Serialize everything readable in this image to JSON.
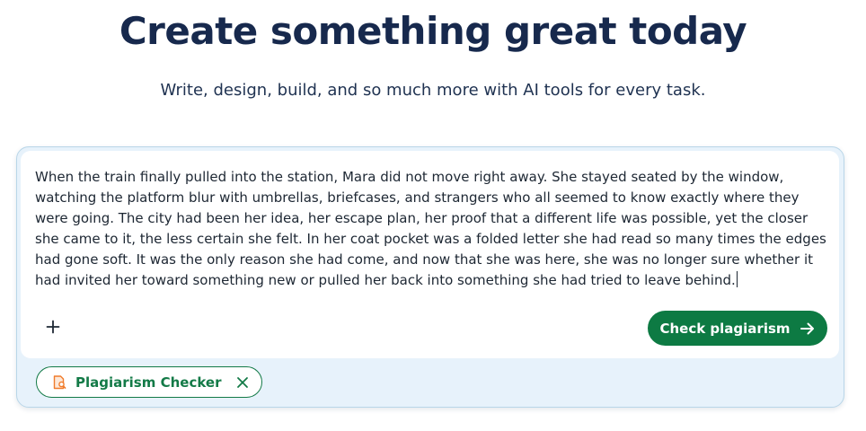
{
  "hero": {
    "title": "Create something great today",
    "subtitle": "Write, design, build, and so much more with AI tools for every task."
  },
  "editor": {
    "text": "When the train finally pulled into the station, Mara did not move right away. She stayed seated by the window, watching the platform blur with umbrellas, briefcases, and strangers who all seemed to know exactly where they were going. The city had been her idea, her escape plan, her proof that a different life was possible, yet the closer she came to it, the less certain she felt. In her coat pocket was a folded letter she had read so many times the edges had gone soft. It was the only reason she had come, and now that she was here, she was no longer sure whether it had invited her toward something new or pulled her back into something she had tried to leave behind."
  },
  "toolbar": {
    "add_icon": "plus-icon",
    "check_label": "Check plagiarism",
    "check_icon": "arrow-right-icon"
  },
  "chip": {
    "label": "Plagiarism Checker",
    "icon": "document-search-icon",
    "close_icon": "close-icon"
  },
  "colors": {
    "title": "#17294d",
    "accent_green": "#0d7a43",
    "panel_background": "#e7f2fb",
    "panel_border": "#b9d6e8",
    "chip_icon_orange": "#f07b2b"
  }
}
